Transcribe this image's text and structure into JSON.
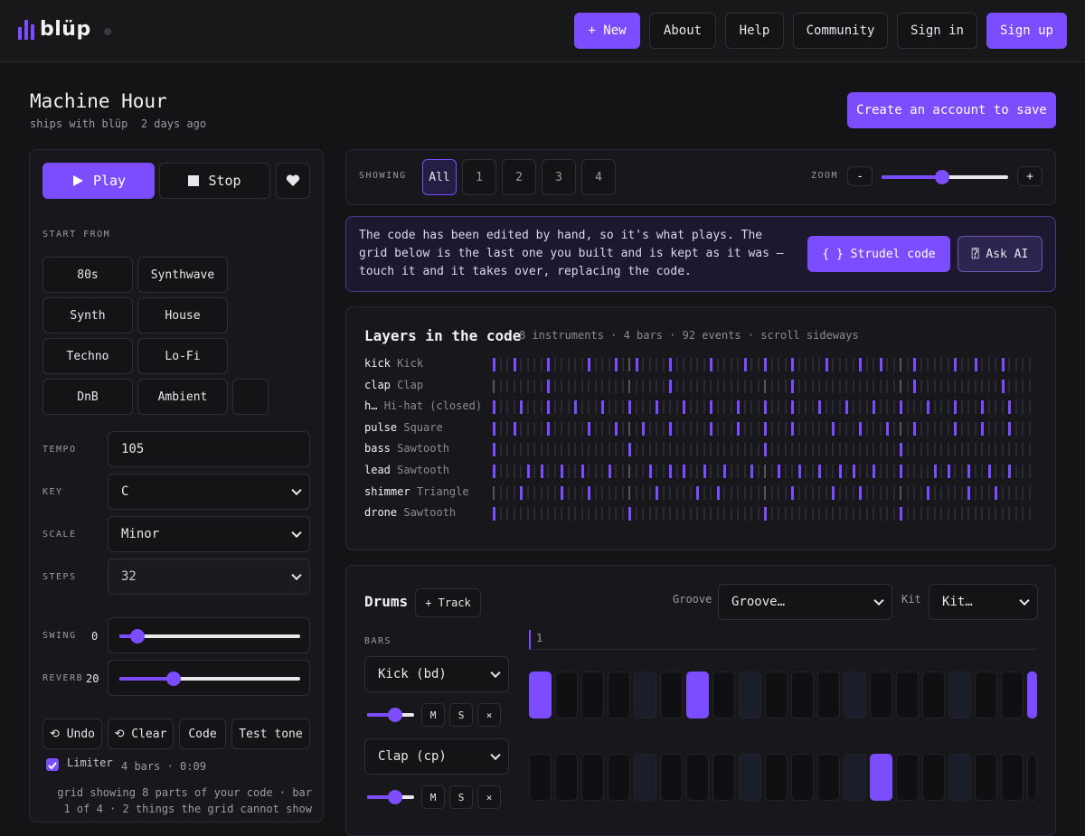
{
  "brand": {
    "name": "blüp"
  },
  "nav": {
    "new": "+ New",
    "about": "About",
    "help": "Help",
    "community": "Community",
    "signin": "Sign in",
    "signup": "Sign up"
  },
  "project": {
    "title": "Machine Hour",
    "author_line": "ships with blüp",
    "age": "2 days ago",
    "save": "Create an account to save"
  },
  "transport": {
    "play": "Play",
    "stop": "Stop"
  },
  "presets": {
    "label": "START FROM",
    "items": [
      "80s",
      "Synthwave",
      "Synth",
      "House",
      "Techno",
      "Lo-Fi",
      "DnB",
      "Ambient"
    ]
  },
  "settings": {
    "tempo_label": "TEMPO",
    "tempo": "105",
    "key_label": "KEY",
    "key": "C",
    "scale_label": "SCALE",
    "scale": "Minor",
    "steps_label": "STEPS",
    "steps": "32",
    "swing_label": "SWING",
    "swing": "0",
    "swing_value": 0.1,
    "reverb_label": "REVERB",
    "reverb": "20",
    "reverb_value": 0.3
  },
  "tools": {
    "undo": "⟲ Undo",
    "clear": "⟲ Clear",
    "code": "Code",
    "test": "Test tone"
  },
  "limiter": {
    "label": "Limiter",
    "checked": true,
    "length": "4 bars · 0:09"
  },
  "status_text": "grid showing 8 parts of your code · bar 1 of 4 · 2 things the grid cannot show",
  "showing": {
    "label": "SHOWING",
    "tabs": [
      "All",
      "1",
      "2",
      "3",
      "4"
    ],
    "active": 0
  },
  "zoom": {
    "label": "ZOOM",
    "minus": "-",
    "plus": "+",
    "value": 0.48
  },
  "notice": {
    "text": "The code has been edited by hand, so it's what plays. The grid below is the last one you built and is kept as it was — touch it and it takes over, replacing the code.",
    "strudel": "{ } Strudel code",
    "ask_ai": "⍰ Ask AI"
  },
  "layers": {
    "title": "Layers in the code",
    "meta": "8 instruments · 4 bars · 92 events · scroll sideways",
    "rows": [
      {
        "name": "kick",
        "instrument": "Kick",
        "hits": [
          0,
          3,
          8,
          14,
          18,
          21,
          26,
          32,
          37,
          40,
          44,
          49,
          54,
          57,
          62,
          68,
          71,
          75,
          81
        ]
      },
      {
        "name": "clap",
        "instrument": "Clap",
        "hits": [
          8,
          26,
          44,
          62,
          75
        ]
      },
      {
        "name": "h…",
        "instrument": "Hi-hat (closed)",
        "hits": [
          0,
          4,
          8,
          12,
          16,
          20,
          24,
          28,
          32,
          36,
          40,
          44,
          48,
          52,
          56,
          60,
          64,
          68,
          72,
          76,
          80
        ]
      },
      {
        "name": "pulse",
        "instrument": "Square",
        "hits": [
          0,
          3,
          8,
          14,
          18,
          22,
          26,
          32,
          36,
          40,
          44,
          50,
          54,
          58,
          62,
          68,
          72,
          76,
          80
        ]
      },
      {
        "name": "bass",
        "instrument": "Sawtooth",
        "hits": [
          0,
          20,
          40,
          60
        ]
      },
      {
        "name": "lead",
        "instrument": "Sawtooth",
        "hits": [
          0,
          5,
          7,
          10,
          13,
          17,
          23,
          26,
          28,
          31,
          34,
          38,
          42,
          45,
          48,
          51,
          53,
          56,
          60,
          65,
          67,
          70,
          73,
          76
        ]
      },
      {
        "name": "shimmer",
        "instrument": "Triangle",
        "hits": [
          4,
          10,
          14,
          24,
          30,
          33,
          44,
          50,
          54,
          64,
          70,
          74
        ]
      },
      {
        "name": "drone",
        "instrument": "Sawtooth",
        "hits": [
          0,
          20,
          40,
          60
        ]
      }
    ]
  },
  "drums": {
    "title": "Drums",
    "add_track": "+ Track",
    "groove_label": "Groove",
    "groove": "Groove…",
    "kit_label": "Kit",
    "kit": "Kit…",
    "bars_label": "BARS",
    "bar_number": "1",
    "tracks": [
      {
        "name": "Kick (bd)",
        "volume": 0.6,
        "mute": "M",
        "solo": "S",
        "remove": "×",
        "on": [
          0,
          6,
          19
        ]
      },
      {
        "name": "Clap (cp)",
        "volume": 0.6,
        "mute": "M",
        "solo": "S",
        "remove": "×",
        "on": [
          13
        ]
      }
    ]
  }
}
